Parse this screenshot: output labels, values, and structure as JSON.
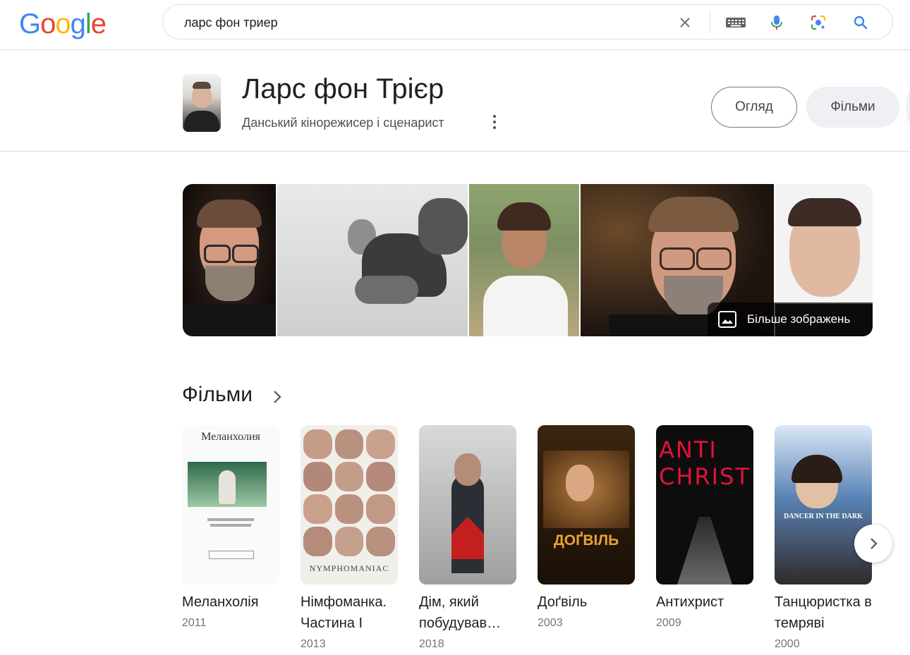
{
  "search": {
    "query": "ларс фон триер"
  },
  "logo": {
    "letters": [
      "G",
      "o",
      "o",
      "g",
      "l",
      "e"
    ],
    "colors": [
      "#4285F4",
      "#EA4335",
      "#FBBC05",
      "#4285F4",
      "#34A853",
      "#EA4335"
    ]
  },
  "entity": {
    "title": "Ларс фон Трієр",
    "subtitle": "Данський кінорежисер і сценарист",
    "chips": [
      {
        "label": "Огляд",
        "active": true
      },
      {
        "label": "Фільми",
        "active": false
      }
    ]
  },
  "images": {
    "more_label": "Більше зображень"
  },
  "films": {
    "section_title": "Фільми",
    "items": [
      {
        "title": "Меланхолія",
        "year": "2011",
        "poster_text": "Меланхолия"
      },
      {
        "title": "Німфоманка. Частина I",
        "year": "2013",
        "poster_text": "NYMPHOMANIAC"
      },
      {
        "title": "Дім, який побудував…",
        "year": "2018",
        "poster_text": ""
      },
      {
        "title": "Доґвіль",
        "year": "2003",
        "poster_text": "ДОҐВІЛЬ"
      },
      {
        "title": "Антихрист",
        "year": "2009",
        "poster_text": "ANTI CHRIST"
      },
      {
        "title": "Танцюристка в темряві",
        "year": "2000",
        "poster_text": "DANCER IN THE DARK"
      }
    ]
  },
  "colors": {
    "accent_blue": "#4285F4",
    "mic_red": "#EA4335"
  }
}
